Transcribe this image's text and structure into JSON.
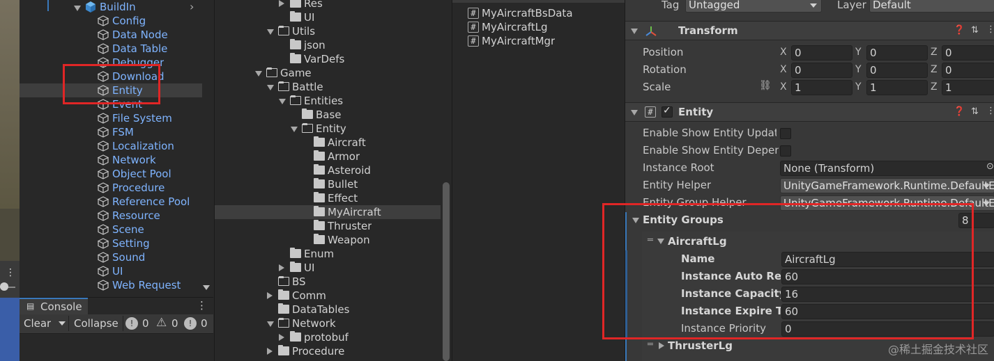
{
  "hierarchy": {
    "root_label": "BuildIn",
    "items": [
      "Config",
      "Data Node",
      "Data Table",
      "Debugger",
      "Download",
      "Entity",
      "Event",
      "File System",
      "FSM",
      "Localization",
      "Network",
      "Object Pool",
      "Procedure",
      "Reference Pool",
      "Resource",
      "Scene",
      "Setting",
      "Sound",
      "UI",
      "Web Request"
    ],
    "selected": "Entity"
  },
  "console": {
    "tab_label": "Console",
    "clear_label": "Clear",
    "collapse_label": "Collapse",
    "info_count": "0",
    "warning_count": "0",
    "error_count": "0"
  },
  "project_tree": {
    "rows": [
      {
        "label": "Res",
        "depth": 2,
        "arrow": "right"
      },
      {
        "label": "UI",
        "depth": 2,
        "arrow": "none"
      },
      {
        "label": "Utils",
        "depth": 1,
        "arrow": "down"
      },
      {
        "label": "json",
        "depth": 2,
        "arrow": "none"
      },
      {
        "label": "VarDefs",
        "depth": 2,
        "arrow": "none"
      },
      {
        "label": "Game",
        "depth": 0,
        "arrow": "down"
      },
      {
        "label": "Battle",
        "depth": 1,
        "arrow": "down"
      },
      {
        "label": "Entities",
        "depth": 2,
        "arrow": "down"
      },
      {
        "label": "Base",
        "depth": 3,
        "arrow": "none"
      },
      {
        "label": "Entity",
        "depth": 3,
        "arrow": "down"
      },
      {
        "label": "Aircraft",
        "depth": 4,
        "arrow": "none"
      },
      {
        "label": "Armor",
        "depth": 4,
        "arrow": "none"
      },
      {
        "label": "Asteroid",
        "depth": 4,
        "arrow": "none"
      },
      {
        "label": "Bullet",
        "depth": 4,
        "arrow": "none"
      },
      {
        "label": "Effect",
        "depth": 4,
        "arrow": "none"
      },
      {
        "label": "MyAircraft",
        "depth": 4,
        "arrow": "none"
      },
      {
        "label": "Thruster",
        "depth": 4,
        "arrow": "none"
      },
      {
        "label": "Weapon",
        "depth": 4,
        "arrow": "none"
      },
      {
        "label": "Enum",
        "depth": 2,
        "arrow": "none"
      },
      {
        "label": "UI",
        "depth": 2,
        "arrow": "right"
      },
      {
        "label": "BS",
        "depth": 1,
        "arrow": "none"
      },
      {
        "label": "Comm",
        "depth": 1,
        "arrow": "right"
      },
      {
        "label": "DataTables",
        "depth": 1,
        "arrow": "none"
      },
      {
        "label": "Network",
        "depth": 1,
        "arrow": "down"
      },
      {
        "label": "protobuf",
        "depth": 2,
        "arrow": "right"
      },
      {
        "label": "Procedure",
        "depth": 1,
        "arrow": "right"
      }
    ],
    "selected": "MyAircraft"
  },
  "files": [
    "MyAircraftBsData",
    "MyAircraftLg",
    "MyAircraftMgr"
  ],
  "inspector": {
    "tag_label": "Tag",
    "tag_value": "Untagged",
    "layer_label": "Layer",
    "layer_value": "Default",
    "transform": {
      "title": "Transform",
      "rows": [
        {
          "label": "Position",
          "x": "0",
          "y": "0",
          "z": "0"
        },
        {
          "label": "Rotation",
          "x": "0",
          "y": "0",
          "z": "0"
        },
        {
          "label": "Scale",
          "x": "1",
          "y": "1",
          "z": "1"
        }
      ]
    },
    "entity": {
      "title": "Entity",
      "enable_update_label": "Enable Show Entity Update",
      "enable_depend_label": "Enable Show Entity Depend",
      "instance_root_label": "Instance Root",
      "instance_root_value": "None (Transform)",
      "entity_helper_label": "Entity Helper",
      "entity_helper_value": "UnityGameFramework.Runtime.DefaultEr",
      "group_helper_label": "Entity Group Helper",
      "group_helper_value": "UnityGameFramework.Runtime.DefaultEr",
      "groups_label": "Entity Groups",
      "groups_count": "8",
      "group": {
        "title": "AircraftLg",
        "name_label": "Name",
        "name_value": "AircraftLg",
        "auto_release_label": "Instance Auto Release",
        "auto_release_value": "60",
        "capacity_label": "Instance Capacity",
        "capacity_value": "16",
        "expire_label": "Instance Expire Time",
        "expire_value": "60",
        "priority_label": "Instance Priority",
        "priority_value": "0"
      },
      "next_group": "ThrusterLg"
    }
  },
  "watermark": "@稀土掘金技术社区"
}
